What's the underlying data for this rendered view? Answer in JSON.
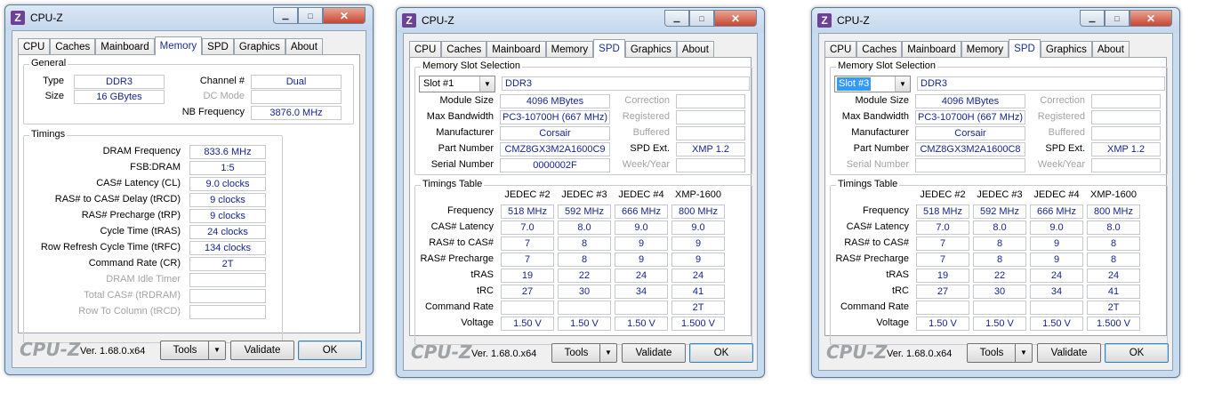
{
  "colors": {
    "value_text": "#16258f",
    "active_tab": "#1a2f96",
    "close_button": "#c74531",
    "logo": "#6c4196"
  },
  "window1": {
    "title": "CPU-Z",
    "tabs": [
      "CPU",
      "Caches",
      "Mainboard",
      "Memory",
      "SPD",
      "Graphics",
      "About"
    ],
    "active_tab": "Memory",
    "general": {
      "title": "General",
      "type_label": "Type",
      "type": "DDR3",
      "size_label": "Size",
      "size": "16 GBytes",
      "channel_label": "Channel #",
      "channel": "Dual",
      "dc_mode_label": "DC Mode",
      "dc_mode": "",
      "nb_freq_label": "NB Frequency",
      "nb_freq": "3876.0 MHz"
    },
    "timings": {
      "title": "Timings",
      "rows": [
        {
          "label": "DRAM Frequency",
          "value": "833.6 MHz",
          "disabled": false
        },
        {
          "label": "FSB:DRAM",
          "value": "1:5",
          "disabled": false
        },
        {
          "label": "CAS# Latency (CL)",
          "value": "9.0 clocks",
          "disabled": false
        },
        {
          "label": "RAS# to CAS# Delay (tRCD)",
          "value": "9 clocks",
          "disabled": false
        },
        {
          "label": "RAS# Precharge (tRP)",
          "value": "9 clocks",
          "disabled": false
        },
        {
          "label": "Cycle Time (tRAS)",
          "value": "24 clocks",
          "disabled": false
        },
        {
          "label": "Row Refresh Cycle Time (tRFC)",
          "value": "134 clocks",
          "disabled": false
        },
        {
          "label": "Command Rate (CR)",
          "value": "2T",
          "disabled": false
        },
        {
          "label": "DRAM Idle Timer",
          "value": "",
          "disabled": true
        },
        {
          "label": "Total CAS# (tRDRAM)",
          "value": "",
          "disabled": true
        },
        {
          "label": "Row To Column (tRCD)",
          "value": "",
          "disabled": true
        }
      ]
    },
    "footer": {
      "brand": "CPU-Z",
      "version": "Ver. 1.68.0.x64",
      "tools": "Tools",
      "validate": "Validate",
      "ok": "OK"
    }
  },
  "window2": {
    "title": "CPU-Z",
    "tabs": [
      "CPU",
      "Caches",
      "Mainboard",
      "Memory",
      "SPD",
      "Graphics",
      "About"
    ],
    "active_tab": "SPD",
    "slot_selection_title": "Memory Slot Selection",
    "slot": "Slot #1",
    "slot_type": "DDR3",
    "module_size_label": "Module Size",
    "module_size": "4096 MBytes",
    "max_bw_label": "Max Bandwidth",
    "max_bw": "PC3-10700H (667 MHz)",
    "manufacturer_label": "Manufacturer",
    "manufacturer": "Corsair",
    "part_label": "Part Number",
    "part": "CMZ8GX3M2A1600C9",
    "serial_label": "Serial Number",
    "serial": "0000002F",
    "correction_label": "Correction",
    "registered_label": "Registered",
    "buffered_label": "Buffered",
    "spd_ext_label": "SPD Ext.",
    "spd_ext": "XMP 1.2",
    "weekyear_label": "Week/Year",
    "timings_title": "Timings Table",
    "columns": [
      "JEDEC #2",
      "JEDEC #3",
      "JEDEC #4",
      "XMP-1600"
    ],
    "rows": [
      {
        "label": "Frequency",
        "values": [
          "518 MHz",
          "592 MHz",
          "666 MHz",
          "800 MHz"
        ]
      },
      {
        "label": "CAS# Latency",
        "values": [
          "7.0",
          "8.0",
          "9.0",
          "9.0"
        ]
      },
      {
        "label": "RAS# to CAS#",
        "values": [
          "7",
          "8",
          "9",
          "9"
        ]
      },
      {
        "label": "RAS# Precharge",
        "values": [
          "7",
          "8",
          "9",
          "9"
        ]
      },
      {
        "label": "tRAS",
        "values": [
          "19",
          "22",
          "24",
          "24"
        ]
      },
      {
        "label": "tRC",
        "values": [
          "27",
          "30",
          "34",
          "41"
        ]
      },
      {
        "label": "Command Rate",
        "values": [
          "",
          "",
          "",
          "2T"
        ]
      },
      {
        "label": "Voltage",
        "values": [
          "1.50 V",
          "1.50 V",
          "1.50 V",
          "1.500 V"
        ]
      }
    ],
    "footer": {
      "brand": "CPU-Z",
      "version": "Ver. 1.68.0.x64",
      "tools": "Tools",
      "validate": "Validate",
      "ok": "OK"
    }
  },
  "window3": {
    "title": "CPU-Z",
    "tabs": [
      "CPU",
      "Caches",
      "Mainboard",
      "Memory",
      "SPD",
      "Graphics",
      "About"
    ],
    "active_tab": "SPD",
    "slot_selection_title": "Memory Slot Selection",
    "slot": "Slot #3",
    "slot_type": "DDR3",
    "module_size_label": "Module Size",
    "module_size": "4096 MBytes",
    "max_bw_label": "Max Bandwidth",
    "max_bw": "PC3-10700H (667 MHz)",
    "manufacturer_label": "Manufacturer",
    "manufacturer": "Corsair",
    "part_label": "Part Number",
    "part": "CMZ8GX3M2A1600C8",
    "serial_label": "Serial Number",
    "serial": "",
    "correction_label": "Correction",
    "registered_label": "Registered",
    "buffered_label": "Buffered",
    "spd_ext_label": "SPD Ext.",
    "spd_ext": "XMP 1.2",
    "weekyear_label": "Week/Year",
    "timings_title": "Timings Table",
    "columns": [
      "JEDEC #2",
      "JEDEC #3",
      "JEDEC #4",
      "XMP-1600"
    ],
    "rows": [
      {
        "label": "Frequency",
        "values": [
          "518 MHz",
          "592 MHz",
          "666 MHz",
          "800 MHz"
        ]
      },
      {
        "label": "CAS# Latency",
        "values": [
          "7.0",
          "8.0",
          "9.0",
          "8.0"
        ]
      },
      {
        "label": "RAS# to CAS#",
        "values": [
          "7",
          "8",
          "9",
          "8"
        ]
      },
      {
        "label": "RAS# Precharge",
        "values": [
          "7",
          "8",
          "9",
          "8"
        ]
      },
      {
        "label": "tRAS",
        "values": [
          "19",
          "22",
          "24",
          "24"
        ]
      },
      {
        "label": "tRC",
        "values": [
          "27",
          "30",
          "34",
          "41"
        ]
      },
      {
        "label": "Command Rate",
        "values": [
          "",
          "",
          "",
          "2T"
        ]
      },
      {
        "label": "Voltage",
        "values": [
          "1.50 V",
          "1.50 V",
          "1.50 V",
          "1.500 V"
        ]
      }
    ],
    "footer": {
      "brand": "CPU-Z",
      "version": "Ver. 1.68.0.x64",
      "tools": "Tools",
      "validate": "Validate",
      "ok": "OK"
    }
  }
}
